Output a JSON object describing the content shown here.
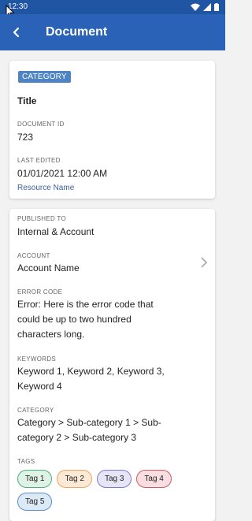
{
  "status_bar": {
    "time": "12:30",
    "icons": [
      "wifi-icon",
      "signal-icon",
      "battery-icon"
    ]
  },
  "app_bar": {
    "title": "Document",
    "back_icon": "arrow-left-icon"
  },
  "card1": {
    "badge": "CATEGORY",
    "title": "Title",
    "document_id_label": "DOCUMENT ID",
    "document_id": "723",
    "last_edited_label": "LAST EDITED",
    "last_edited": "01/01/2021 12:00 AM",
    "resource_link": "Resource Name"
  },
  "card2": {
    "published_to_label": "PUBLISHED TO",
    "published_to": "Internal & Account",
    "account_label": "ACCOUNT",
    "account": "Account Name",
    "error_code_label": "ERROR CODE",
    "error_code": "Error: Here is the error code that could be up to two hundred characters long.",
    "keywords_label": "KEYWORDS",
    "keywords": "Keyword 1, Keyword 2, Keyword 3, Keyword 4",
    "category_label": "CATEGORY",
    "category": "Category > Sub-category 1 > Sub-category 2 > Sub-category 3",
    "tags_label": "TAGS",
    "tags": [
      "Tag 1",
      "Tag 2",
      "Tag 3",
      "Tag 4",
      "Tag 5"
    ]
  },
  "colors": {
    "status_bar": "#1f55a3",
    "app_bar": "#2a62b8",
    "badge": "#4f84c4",
    "link": "#3b5fa0"
  }
}
